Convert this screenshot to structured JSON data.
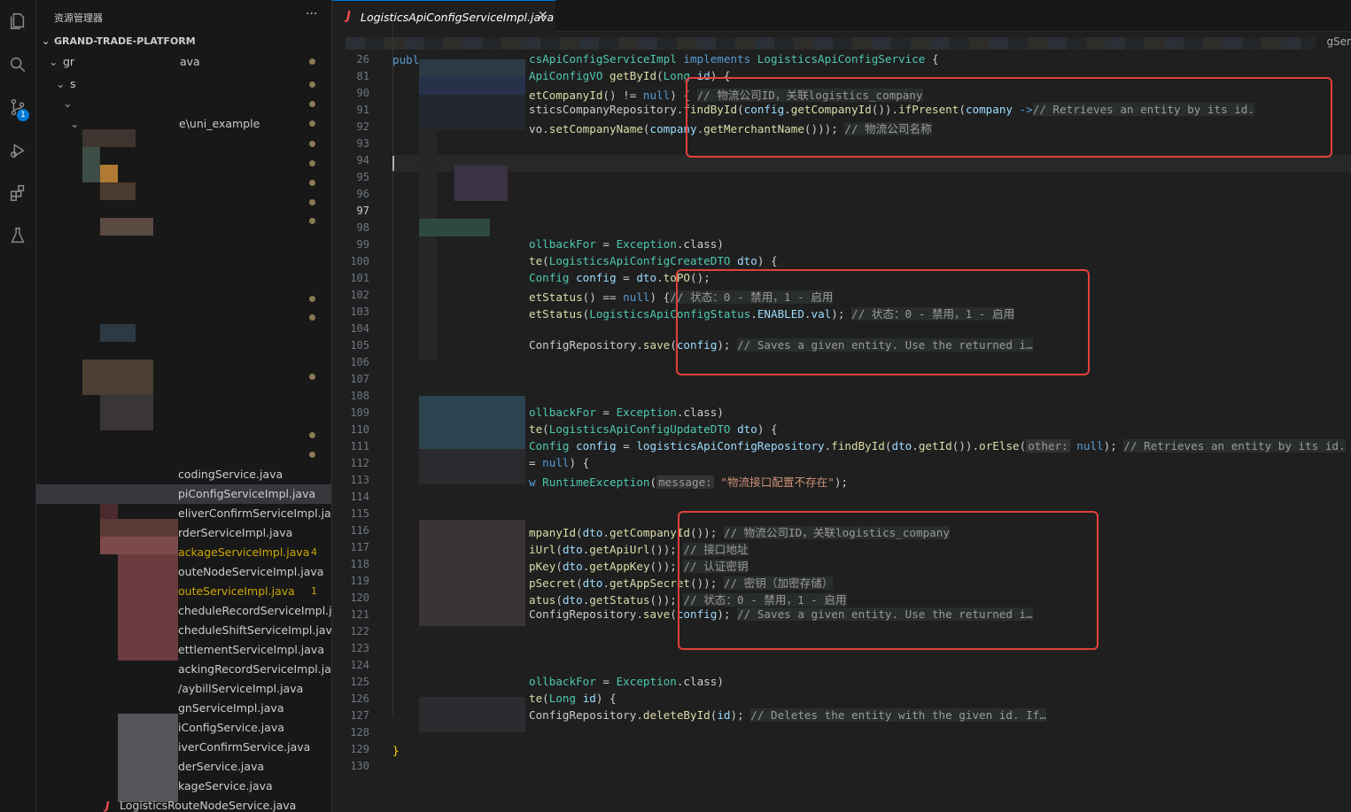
{
  "activity_bar": {
    "icons": [
      "files-icon",
      "search-icon",
      "source-control-icon",
      "run-debug-icon",
      "extensions-icon",
      "testing-icon"
    ],
    "source_control_badge": "1"
  },
  "sidebar": {
    "title": "资源管理器",
    "more": "···",
    "project": "GRAND-TRADE-PLATFORM",
    "tree_top": [
      {
        "text": "gr",
        "suffix": "ava"
      },
      {
        "text": "s"
      },
      {
        "text": ""
      },
      {
        "text": "e\\uni_example"
      }
    ],
    "files": [
      {
        "name": "codingService.java"
      },
      {
        "name": "piConfigServiceImpl.java",
        "active": true
      },
      {
        "name": "eliverConfirmServiceImpl.java"
      },
      {
        "name": "rderServiceImpl.java"
      },
      {
        "name": "ackageServiceImpl.java",
        "count": "4",
        "warn": true
      },
      {
        "name": "outeNodeServiceImpl.java"
      },
      {
        "name": "outeServiceImpl.java",
        "count": "1",
        "warn": true
      },
      {
        "name": "cheduleRecordServiceImpl.ja..."
      },
      {
        "name": "cheduleShiftServiceImpl.java"
      },
      {
        "name": "ettlementServiceImpl.java"
      },
      {
        "name": "ackingRecordServiceImpl.java"
      },
      {
        "name": "/aybillServiceImpl.java"
      },
      {
        "name": "gnServiceImpl.java"
      },
      {
        "name": "iConfigService.java"
      },
      {
        "name": "iverConfirmService.java"
      },
      {
        "name": "derService.java"
      },
      {
        "name": "kageService.java"
      },
      {
        "name": "LogisticsRouteNodeService.java"
      }
    ]
  },
  "editor": {
    "tab": {
      "icon": "J",
      "name": "LogisticsApiConfigServiceImpl.java",
      "close": "✕"
    },
    "breadcrumb_end": "gSer",
    "line_numbers": [
      "26",
      "81",
      "90",
      "91",
      "92",
      "93",
      "94",
      "95",
      "96",
      "97",
      "98",
      "99",
      "100",
      "101",
      "102",
      "103",
      "104",
      "105",
      "106",
      "107",
      "108",
      "109",
      "110",
      "111",
      "112",
      "113",
      "114",
      "115",
      "116",
      "117",
      "118",
      "119",
      "120",
      "121",
      "122",
      "123",
      "124",
      "125",
      "126",
      "127",
      "128",
      "129",
      "130"
    ],
    "current_line": "97",
    "pre_text": {
      "line26": "publ",
      "line129": "}"
    }
  },
  "code": {
    "l26": [
      "csApiConfigServiceImpl ",
      "implements ",
      "LogisticsApiConfigService",
      " {"
    ],
    "l81": [
      "ApiConfigVO ",
      "getById",
      "(",
      "Long ",
      "id",
      ") {"
    ],
    "l90": [
      "etCompanyId",
      "() != ",
      "null",
      ") { ",
      "// 物流公司ID，关联logistics_company"
    ],
    "l91": [
      "sticsCompanyRepository.",
      "findById",
      "(",
      "config",
      ".",
      "getCompanyId",
      "()).",
      "ifPresent",
      "(",
      "company",
      " ->",
      "// Retrieves an entity by its id."
    ],
    "l92": [
      "vo.",
      "setCompanyName",
      "(",
      "company",
      ".",
      "getMerchantName",
      "())); ",
      "// 物流公司名称"
    ],
    "l99": [
      "ollbackFor",
      " = ",
      "Exception",
      ".class)"
    ],
    "l100": [
      "te",
      "(",
      "LogisticsApiConfigCreateDTO",
      " ",
      "dto",
      ") {"
    ],
    "l101": [
      "Config ",
      "config",
      " = ",
      "dto",
      ".",
      "toPO",
      "();"
    ],
    "l102": [
      "etStatus",
      "() == ",
      "null",
      ") {",
      "// 状态：0 - 禁用，1 - 启用"
    ],
    "l103": [
      "etStatus",
      "(",
      "LogisticsApiConfigStatus",
      ".",
      "ENABLED",
      ".",
      "val",
      "); ",
      "// 状态：0 - 禁用，1 - 启用"
    ],
    "l105": [
      "ConfigRepository.",
      "save",
      "(",
      "config",
      "); ",
      "// Saves a given entity. Use the returned i…"
    ],
    "l109": [
      "ollbackFor",
      " = ",
      "Exception",
      ".class)"
    ],
    "l110": [
      "te",
      "(",
      "LogisticsApiConfigUpdateDTO",
      " ",
      "dto",
      ") {"
    ],
    "l111": [
      "Config ",
      "config",
      " = ",
      "logisticsApiConfigRepository",
      ".",
      "findById",
      "(",
      "dto",
      ".",
      "getId",
      "()).",
      "orElse",
      "(",
      "other:",
      " null",
      "); ",
      "// Retrieves an entity by its id."
    ],
    "l112": [
      "= ",
      "null",
      ") {"
    ],
    "l113": [
      "w ",
      "RuntimeException",
      "(",
      "message:",
      " \"物流接口配置不存在\"",
      ");"
    ],
    "l116": [
      "mpanyId",
      "(",
      "dto",
      ".",
      "getCompanyId",
      "()); ",
      "// 物流公司ID，关联logistics_company"
    ],
    "l117": [
      "iUrl",
      "(",
      "dto",
      ".",
      "getApiUrl",
      "()); ",
      "// 接口地址"
    ],
    "l118": [
      "pKey",
      "(",
      "dto",
      ".",
      "getAppKey",
      "()); ",
      "// 认证密钥"
    ],
    "l119": [
      "pSecret",
      "(",
      "dto",
      ".",
      "getAppSecret",
      "()); ",
      "// 密钥（加密存储）"
    ],
    "l120": [
      "atus",
      "(",
      "dto",
      ".",
      "getStatus",
      "()); ",
      "// 状态：0 - 禁用，1 - 启用"
    ],
    "l121": [
      "ConfigRepository.",
      "save",
      "(",
      "config",
      "); ",
      "// Saves a given entity. Use the returned i…"
    ],
    "l125": [
      "ollbackFor",
      " = ",
      "Exception",
      ".class)"
    ],
    "l126": [
      "te",
      "(",
      "Long ",
      "id",
      ") {"
    ],
    "l127": [
      "ConfigRepository.",
      "deleteById",
      "(",
      "id",
      "); ",
      "// Deletes the entity with the given id. If…"
    ]
  },
  "colors": {
    "highlight_box": "#e2413a",
    "accent": "#0078d4",
    "warning": "#cca700"
  }
}
